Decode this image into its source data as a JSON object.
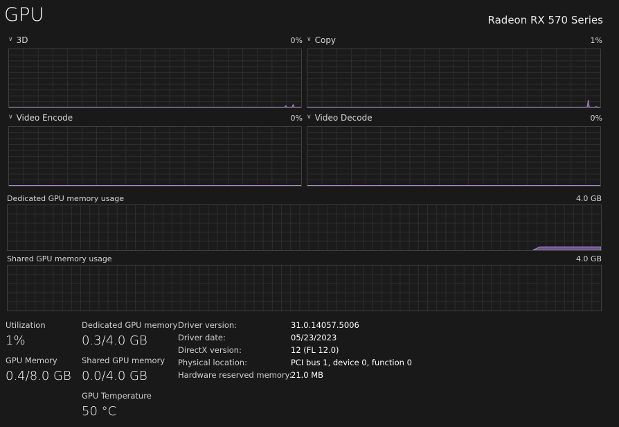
{
  "header": {
    "title": "GPU",
    "adapter": "Radeon RX 570 Series"
  },
  "engines": [
    {
      "label": "3D",
      "percent": "0%",
      "samples": [
        0,
        0,
        0,
        0,
        0,
        0,
        0,
        0,
        0,
        0,
        0,
        0,
        0,
        0,
        0,
        0,
        0,
        0,
        0,
        0,
        0,
        0,
        0,
        0,
        0,
        0,
        0,
        0,
        0,
        0,
        0,
        0,
        0,
        0,
        0,
        0,
        0,
        0,
        0,
        0,
        0,
        0,
        0,
        0,
        0,
        0,
        0,
        0,
        0,
        0,
        0,
        0,
        0,
        0,
        0,
        0,
        0,
        0,
        0,
        0,
        0,
        0,
        0,
        0,
        0,
        0,
        0,
        0,
        0,
        0,
        0,
        0,
        0,
        0,
        0,
        0,
        0,
        0,
        0,
        0,
        0,
        0,
        0,
        0,
        0,
        0,
        0,
        0,
        0,
        0,
        0,
        0,
        0,
        0,
        0,
        0,
        0,
        0,
        0,
        0,
        0,
        0,
        0,
        0,
        0,
        0,
        0,
        0,
        0,
        0,
        0,
        0,
        0,
        0,
        0,
        0,
        0,
        0,
        0,
        0,
        0,
        0,
        0,
        0,
        0,
        0,
        0,
        0,
        0,
        0,
        0,
        0,
        0,
        0,
        0,
        0,
        0,
        0,
        0,
        0,
        0,
        0,
        0,
        0,
        0,
        0,
        0,
        0,
        0,
        0,
        0,
        0,
        0,
        0,
        0,
        0,
        0,
        0,
        0,
        0,
        0,
        0,
        0,
        0,
        0,
        0,
        0,
        0,
        0,
        0,
        0,
        0,
        0,
        0,
        0,
        0,
        0,
        0,
        0,
        0,
        0,
        0,
        0,
        0,
        0,
        0,
        0,
        0,
        0,
        0,
        0,
        0,
        0,
        0,
        0,
        0,
        0,
        0,
        0,
        0,
        0,
        0,
        0,
        0,
        0,
        0,
        0,
        0,
        0,
        0,
        0,
        0,
        0,
        0,
        0,
        0,
        0,
        0,
        0,
        0,
        0,
        0,
        0,
        0,
        0,
        0,
        0,
        0,
        0,
        0,
        0,
        0,
        0,
        0,
        0,
        0,
        0,
        0,
        0,
        0,
        0,
        0,
        0,
        0,
        0,
        0,
        0,
        0,
        0,
        0,
        0,
        0,
        0,
        0,
        0,
        0,
        0,
        0,
        0,
        0,
        0,
        0,
        0,
        0,
        0,
        0,
        0,
        0,
        0,
        0,
        0,
        0,
        0,
        0,
        0,
        0,
        0,
        0,
        0,
        0,
        0,
        0,
        0,
        0,
        0,
        0,
        0,
        0,
        0,
        0,
        0,
        0,
        0,
        0,
        0,
        0,
        0,
        0,
        0,
        0,
        0,
        0,
        0,
        0,
        0,
        0,
        0,
        0,
        0,
        0,
        0,
        0,
        0,
        0,
        0,
        0,
        0,
        0,
        0,
        0,
        0,
        0,
        0,
        0,
        0,
        0,
        0,
        0,
        0,
        0,
        0,
        0,
        0,
        0,
        0,
        0,
        0,
        0,
        0,
        0,
        0,
        0,
        0,
        0,
        0,
        0,
        0,
        0,
        0,
        0,
        0,
        0,
        0,
        0,
        0,
        0,
        0,
        0,
        0,
        0,
        0,
        0,
        0,
        0,
        0,
        0,
        0,
        0,
        0,
        0,
        0,
        0,
        0,
        0,
        0,
        0,
        1.5,
        3,
        1.5,
        0,
        0,
        0,
        0,
        0,
        0,
        0,
        2,
        5,
        2,
        0,
        0,
        0,
        0,
        0,
        0,
        0,
        0,
        0,
        0
      ]
    },
    {
      "label": "Copy",
      "percent": "1%",
      "samples": [
        0,
        0,
        0,
        0,
        0,
        0,
        0,
        0,
        0,
        0,
        0,
        0,
        0,
        0,
        0,
        0,
        0,
        0,
        0,
        0,
        0,
        0,
        0,
        0,
        0,
        0,
        0,
        0,
        0,
        0,
        0,
        0,
        0,
        0,
        0,
        0,
        0,
        0,
        0,
        0,
        0,
        0,
        0,
        0,
        0,
        0,
        0,
        0,
        0,
        0,
        0,
        0,
        0,
        0,
        0,
        0,
        0,
        0,
        0,
        0,
        0,
        0,
        0,
        0,
        0,
        0,
        0,
        0,
        0,
        0,
        0,
        0,
        0,
        0,
        0,
        0,
        0,
        0,
        0,
        0,
        0,
        0,
        0,
        0,
        0,
        0,
        0,
        0,
        0,
        0,
        0,
        0,
        0,
        0,
        0,
        0,
        0,
        0,
        0,
        0,
        0,
        0,
        0,
        0,
        0,
        0,
        0,
        0,
        0,
        0,
        0,
        0,
        0,
        0,
        0,
        0,
        0,
        0,
        0,
        0,
        0,
        0,
        0,
        0,
        0,
        0,
        0,
        0,
        0,
        0,
        0,
        0,
        0,
        0,
        0,
        0,
        0,
        0,
        0,
        0,
        0,
        0,
        0,
        0,
        0,
        0,
        0,
        0,
        0,
        0,
        0,
        0,
        0,
        0,
        0,
        0,
        0,
        0,
        0,
        0,
        0,
        0,
        0,
        0,
        0,
        0,
        0,
        0,
        0,
        0,
        0,
        0,
        0,
        0,
        0,
        0,
        0,
        0,
        0,
        0,
        0,
        0,
        0,
        0,
        0,
        0,
        0,
        0,
        0,
        0,
        0,
        0,
        0,
        0,
        0,
        0,
        0,
        0,
        0,
        0,
        0,
        0,
        0,
        0,
        0,
        0,
        0,
        0,
        0,
        0,
        0,
        0,
        0,
        0,
        0,
        0,
        0,
        0,
        0,
        0,
        0,
        0,
        0,
        0,
        0,
        0,
        0,
        0,
        0,
        0,
        0,
        0,
        0,
        0,
        0,
        0,
        0,
        0,
        0,
        0,
        0,
        0,
        0,
        0,
        0,
        0,
        0,
        0,
        0,
        0,
        0,
        0,
        0,
        0,
        0,
        0,
        0,
        0,
        0,
        0,
        0,
        0,
        0,
        0,
        0,
        0,
        0,
        0,
        0,
        0,
        0,
        0,
        0,
        0,
        0,
        0,
        0,
        0,
        0,
        0,
        0,
        0,
        0,
        0,
        0,
        0,
        0,
        0,
        0,
        0,
        0,
        0,
        0,
        0,
        0,
        0,
        0,
        0,
        0,
        0,
        0,
        0,
        0,
        0,
        0,
        0,
        0,
        0,
        0,
        0,
        0,
        0,
        0,
        0,
        0,
        0,
        0,
        0,
        0,
        0,
        0,
        0,
        0,
        0,
        0,
        0,
        0,
        0,
        0,
        0,
        0,
        0,
        0,
        0,
        0,
        0,
        0,
        0,
        0,
        0,
        0,
        0,
        0,
        0,
        0,
        0,
        0,
        0,
        0,
        0,
        0,
        0,
        0,
        0,
        0,
        0,
        0,
        0,
        0,
        0,
        0,
        0,
        0,
        0,
        0,
        0,
        0,
        0,
        0,
        0,
        0,
        0,
        0,
        0,
        0,
        0,
        0,
        0,
        0,
        0,
        0,
        0,
        0,
        0,
        0,
        0,
        0,
        0,
        0,
        0,
        0,
        0,
        0,
        0,
        0,
        4,
        13,
        4,
        0,
        0,
        0,
        0,
        0,
        0,
        0,
        0,
        0,
        1.5,
        1.5,
        0,
        0,
        0,
        0,
        0
      ]
    },
    {
      "label": "Video Encode",
      "percent": "0%",
      "samples": []
    },
    {
      "label": "Video Decode",
      "percent": "0%",
      "samples": []
    }
  ],
  "memory_graphs": [
    {
      "label": "Dedicated GPU memory usage",
      "max": "4.0 GB",
      "level_fraction": 0.075,
      "start_fraction": 0.885
    },
    {
      "label": "Shared GPU memory usage",
      "max": "4.0 GB",
      "level_fraction": 0.0,
      "start_fraction": 1.0
    }
  ],
  "stats": {
    "utilization": {
      "label": "Utilization",
      "value": "1%"
    },
    "gpu_memory": {
      "label": "GPU Memory",
      "value": "0.4/8.0 GB"
    },
    "dedicated": {
      "label": "Dedicated GPU memory",
      "value": "0.3/4.0 GB"
    },
    "shared": {
      "label": "Shared GPU memory",
      "value": "0.0/4.0 GB"
    },
    "temperature": {
      "label": "GPU Temperature",
      "value": "50 °C"
    }
  },
  "info": [
    {
      "key": "Driver version:",
      "value": "31.0.14057.5006"
    },
    {
      "key": "Driver date:",
      "value": "05/23/2023"
    },
    {
      "key": "DirectX version:",
      "value": "12 (FL 12.0)"
    },
    {
      "key": "Physical location:",
      "value": "PCI bus 1, device 0, function 0"
    },
    {
      "key": "Hardware reserved memory:",
      "value": "21.0 MB"
    }
  ],
  "colors": {
    "accent": "#a98bc9",
    "accent_fill": "#6b5389",
    "grid": "#2e2e2e",
    "border": "#3f3f3f"
  }
}
